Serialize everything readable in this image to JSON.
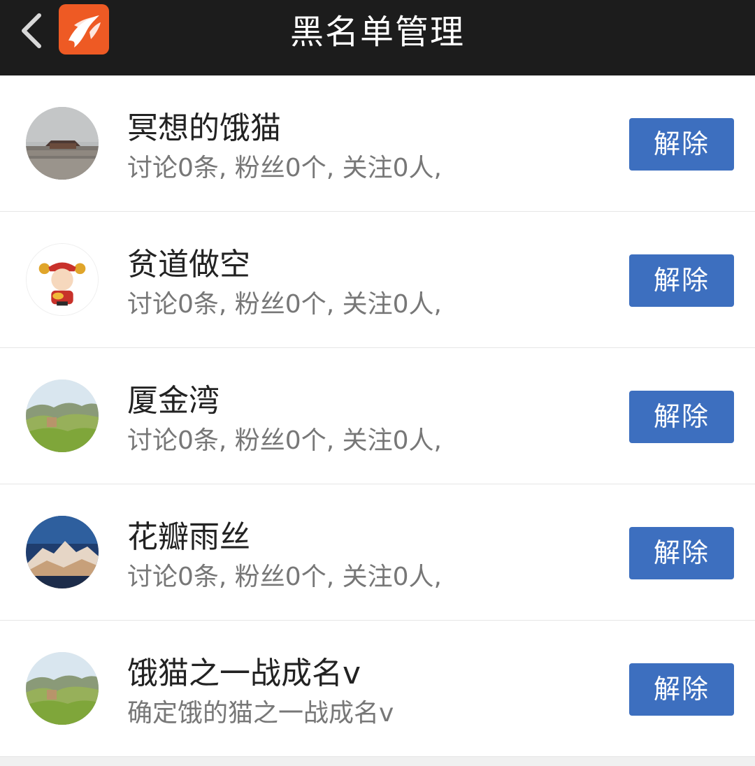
{
  "header": {
    "title": "黑名单管理",
    "back_icon": "chevron-left-icon",
    "logo_icon": "app-logo-icon",
    "background": "#1c1c1c",
    "logo_color": "#ee5a24"
  },
  "blacklist": [
    {
      "name": "冥想的饿猫",
      "stats": "讨论0条, 粉丝0个, 关注0人,",
      "avatar": "palace-avatar",
      "button": "解除"
    },
    {
      "name": "贫道做空",
      "stats": "讨论0条, 粉丝0个, 关注0人,",
      "avatar": "fortune-god-avatar",
      "button": "解除"
    },
    {
      "name": "厦金湾",
      "stats": "讨论0条, 粉丝0个, 关注0人,",
      "avatar": "hills-avatar",
      "button": "解除"
    },
    {
      "name": "花瓣雨丝",
      "stats": "讨论0条, 粉丝0个, 关注0人,",
      "avatar": "mountain-avatar",
      "button": "解除"
    },
    {
      "name": "饿猫之一战成名v",
      "stats": "确定饿的猫之一战成名v",
      "avatar": "hills-avatar",
      "button": "解除"
    }
  ],
  "colors": {
    "button": "#3d6fbf",
    "name_text": "#222222",
    "stats_text": "#777777"
  }
}
